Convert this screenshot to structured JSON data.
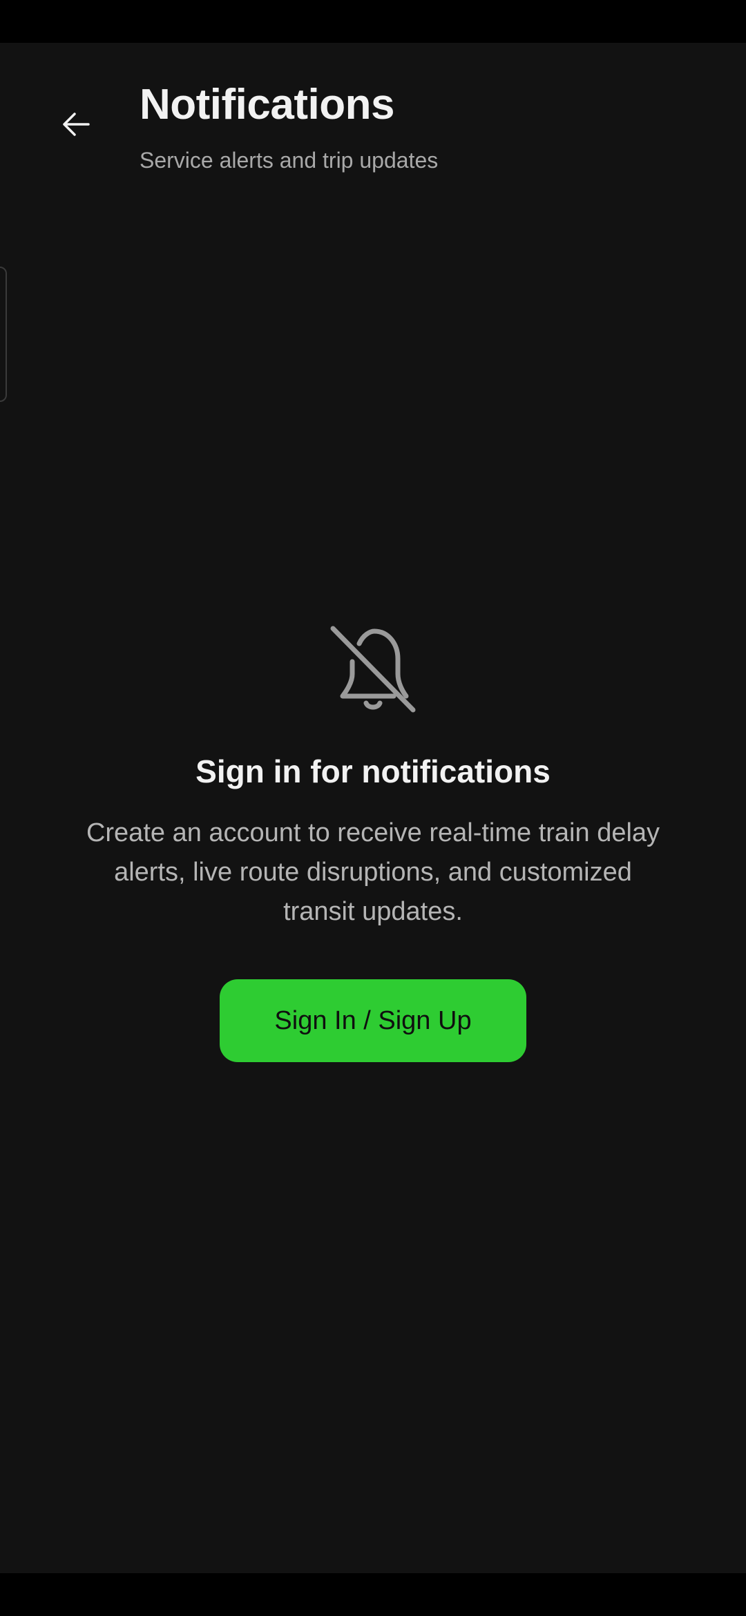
{
  "header": {
    "back_icon": "arrow-left-icon",
    "title": "Notifications",
    "subtitle": "Service alerts and trip updates"
  },
  "empty_state": {
    "icon": "bell-off-icon",
    "title": "Sign in for notifications",
    "description": "Create an account to receive real-time train delay alerts, live route disruptions, and customized transit updates.",
    "button_label": "Sign In / Sign Up"
  },
  "colors": {
    "background": "#121212",
    "accent": "#2ecc32",
    "title_text": "#f2f2f2",
    "secondary_text": "#a9a9a9"
  }
}
